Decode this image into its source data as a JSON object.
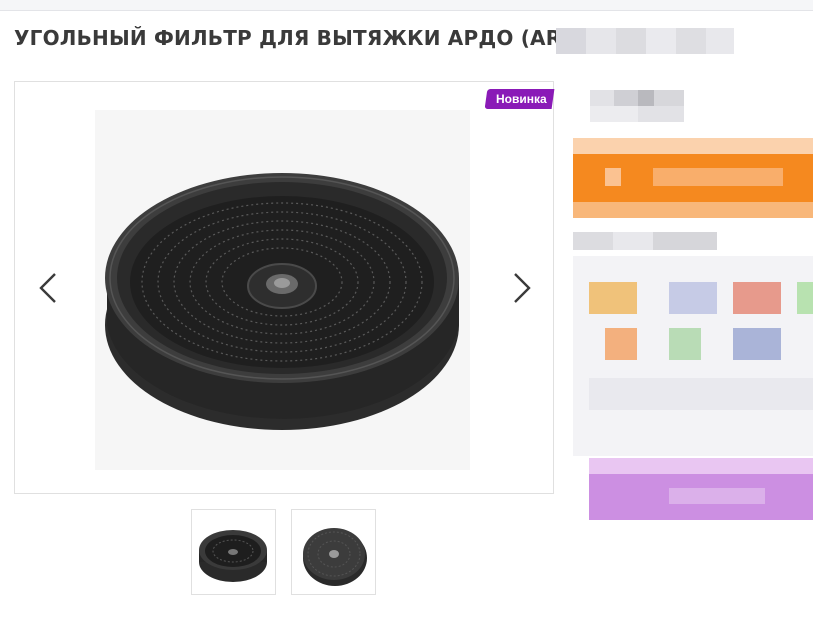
{
  "product": {
    "title": "УГОЛЬНЫЙ ФИЛЬТР ДЛЯ ВЫТЯЖКИ АРДО (ARD",
    "badge": "Новинка"
  },
  "gallery": {
    "main_image": "carbon-filter-round",
    "prev_icon": "chevron-left-icon",
    "next_icon": "chevron-right-icon",
    "thumbnails": [
      "carbon-filter-round-side",
      "carbon-filter-round-top"
    ]
  },
  "colors": {
    "badge": "#8a1ab7",
    "title": "#3a3a3a",
    "buy_button": "#f5891f",
    "secondary_button": "#cc8fe2"
  }
}
